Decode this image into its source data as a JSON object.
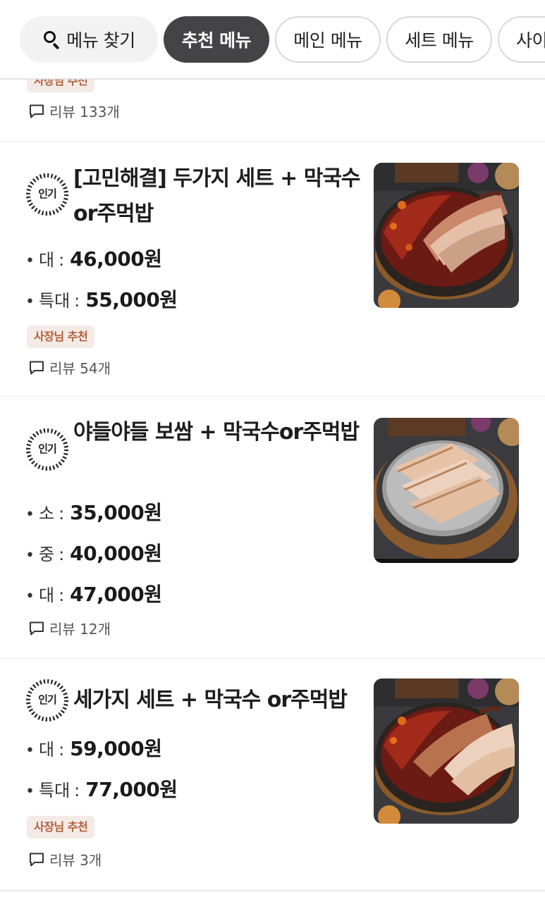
{
  "filters": {
    "search_label": "메뉴 찾기",
    "tabs": [
      {
        "label": "추천 메뉴",
        "active": true
      },
      {
        "label": "메인 메뉴",
        "active": false
      },
      {
        "label": "세트 메뉴",
        "active": false
      },
      {
        "label": "사이",
        "active": false
      }
    ]
  },
  "partial_item": {
    "badge": "사장님 추천",
    "review": "리뷰 133개"
  },
  "items": [
    {
      "popular_label": "인기",
      "title": "[고민해결] 두가지 세트 + 막국수or주먹밥",
      "prices": [
        {
          "size": "대",
          "price": "46,000원"
        },
        {
          "size": "특대",
          "price": "55,000원"
        }
      ],
      "badge": "사장님 추천",
      "review": "리뷰 54개",
      "image": "pork-combo-photo"
    },
    {
      "popular_label": "인기",
      "title": "야들야들 보쌈 + 막국수or주먹밥",
      "prices": [
        {
          "size": "소",
          "price": "35,000원"
        },
        {
          "size": "중",
          "price": "40,000원"
        },
        {
          "size": "대",
          "price": "47,000원"
        }
      ],
      "review": "리뷰 12개",
      "image": "bossam-photo"
    },
    {
      "popular_label": "인기",
      "title": "세가지 세트 + 막국수 or주먹밥",
      "prices": [
        {
          "size": "대",
          "price": "59,000원"
        },
        {
          "size": "특대",
          "price": "77,000원"
        }
      ],
      "badge": "사장님 추천",
      "review": "리뷰 3개",
      "image": "triple-set-photo"
    }
  ],
  "colors": {
    "active_chip": "#444446",
    "owner_badge_bg": "#f4ebe6",
    "owner_badge_text": "#b35f3c"
  }
}
